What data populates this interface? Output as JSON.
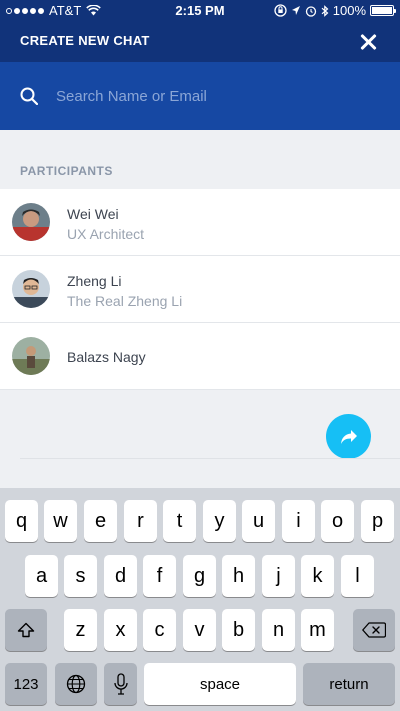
{
  "status_bar": {
    "carrier": "AT&T",
    "time": "2:15 PM",
    "battery": "100%"
  },
  "header": {
    "title": "CREATE NEW CHAT"
  },
  "search": {
    "placeholder": "Search Name or Email"
  },
  "participants": {
    "label": "PARTICIPANTS",
    "items": [
      {
        "name": "Wei Wei",
        "role": "UX Architect"
      },
      {
        "name": "Zheng Li",
        "role": "The Real Zheng Li"
      },
      {
        "name": "Balazs Nagy",
        "role": ""
      }
    ]
  },
  "keyboard": {
    "row1": [
      "q",
      "w",
      "e",
      "r",
      "t",
      "y",
      "u",
      "i",
      "o",
      "p"
    ],
    "row2": [
      "a",
      "s",
      "d",
      "f",
      "g",
      "h",
      "j",
      "k",
      "l"
    ],
    "row3": [
      "z",
      "x",
      "c",
      "v",
      "b",
      "n",
      "m"
    ],
    "numbers_label": "123",
    "space_label": "space",
    "return_label": "return"
  },
  "colors": {
    "header_bg": "#11337a",
    "search_bg": "#1648a3",
    "fab": "#16bff5"
  }
}
